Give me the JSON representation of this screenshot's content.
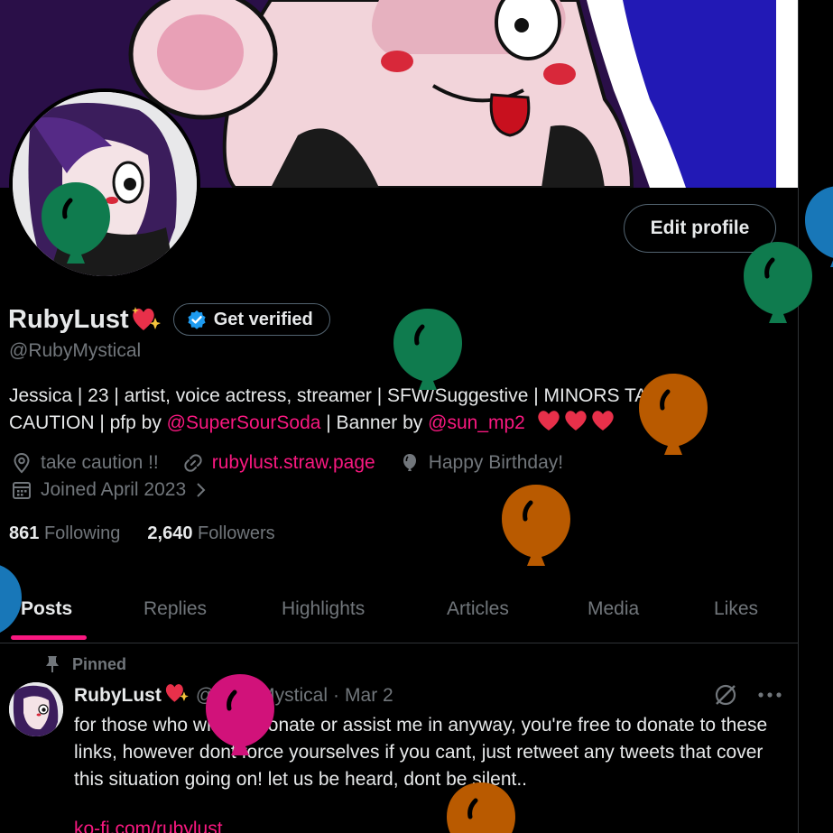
{
  "profile": {
    "name": "RubyLust",
    "handle": "@RubyMystical",
    "edit_label": "Edit profile",
    "verify_label": "Get verified",
    "bio": {
      "line1": "Jessica | 23 | artist, voice actress, streamer | SFW/Suggestive | MINORS TAKE",
      "line2_prefix": "CAUTION | pfp by ",
      "pfp_link": "@SuperSourSoda",
      "banner_prefix": " | Banner by ",
      "banner_link": "@sun_mp2"
    },
    "location": "take caution !!",
    "website": "rubylust.straw.page",
    "birthday": "Happy Birthday!",
    "joined": "Joined April 2023",
    "following_count": "861",
    "following_label": "Following",
    "followers_count": "2,640",
    "followers_label": "Followers"
  },
  "tabs": [
    "Posts",
    "Replies",
    "Highlights",
    "Articles",
    "Media",
    "Likes"
  ],
  "active_tab": "Posts",
  "pinned_post": {
    "pinned_label": "Pinned",
    "author": "RubyLust",
    "handle": "@RubyMystical",
    "separator": "·",
    "date": "Mar 2",
    "text": "for those who wish to donate or assist me in anyway, you're free to donate to these links, however dont force yourselves if you cant, just retweet any tweets that cover this situation going on! let us be heard, dont be silent..",
    "link": "ko-fi.com/rubylust"
  },
  "colors": {
    "accent": "#f91880",
    "verified": "#1d9bf0",
    "muted": "#71767b",
    "balloon_green": "#0f7b4e",
    "balloon_orange": "#b95a00",
    "balloon_pink": "#d1127a",
    "balloon_blue": "#1877b8"
  },
  "icons": [
    "location-icon",
    "link-icon",
    "balloon-icon",
    "calendar-icon",
    "chevron-right-icon",
    "pin-icon",
    "grok-icon",
    "more-icon",
    "verified-badge-icon"
  ]
}
